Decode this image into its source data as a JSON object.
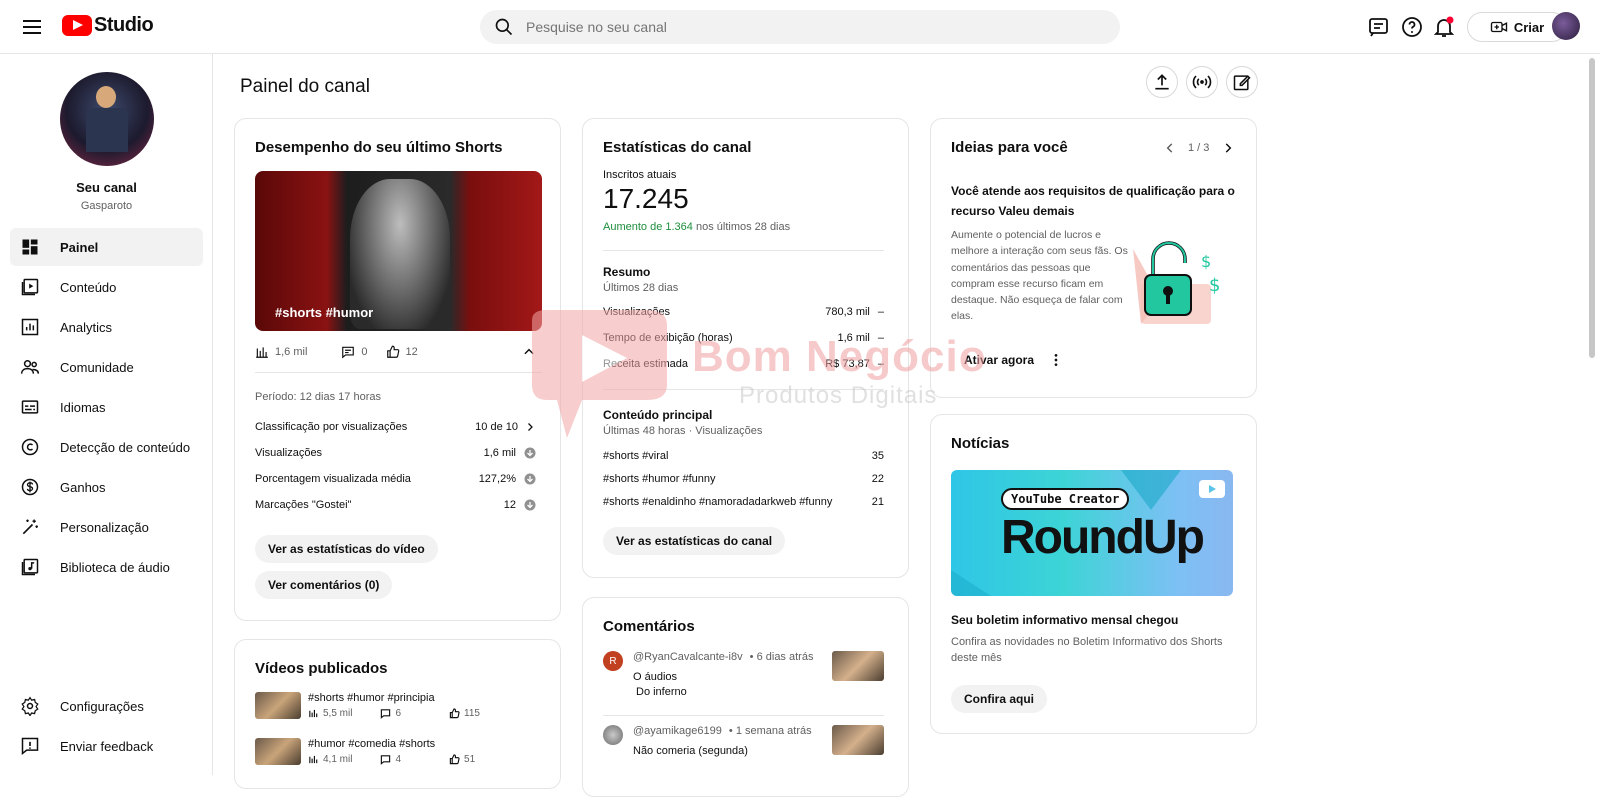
{
  "topbar": {
    "logo_text": "Studio",
    "search_placeholder": "Pesquise no seu canal",
    "create_label": "Criar"
  },
  "sidebar": {
    "channel_name": "Seu canal",
    "channel_handle": "Gasparoto",
    "items": [
      {
        "label": "Painel",
        "icon": "dashboard-icon",
        "active": true
      },
      {
        "label": "Conteúdo",
        "icon": "content-icon"
      },
      {
        "label": "Analytics",
        "icon": "analytics-icon"
      },
      {
        "label": "Comunidade",
        "icon": "community-icon"
      },
      {
        "label": "Idiomas",
        "icon": "subtitles-icon"
      },
      {
        "label": "Detecção de conteúdo",
        "icon": "copyright-icon"
      },
      {
        "label": "Ganhos",
        "icon": "dollar-icon"
      },
      {
        "label": "Personalização",
        "icon": "magic-wand-icon"
      },
      {
        "label": "Biblioteca de áudio",
        "icon": "audio-library-icon"
      }
    ],
    "bottom_items": [
      {
        "label": "Configurações",
        "icon": "gear-icon"
      },
      {
        "label": "Enviar feedback",
        "icon": "feedback-icon"
      }
    ]
  },
  "main": {
    "title": "Painel do canal",
    "shorts_card": {
      "title": "Desempenho do seu último Shorts",
      "thumb_caption": "#shorts #humor",
      "views": "1,6 mil",
      "comments": "0",
      "likes": "12",
      "period": "Período: 12 dias 17 horas",
      "rows": [
        {
          "label": "Classificação por visualizações",
          "value": "10 de 10"
        },
        {
          "label": "Visualizações",
          "value": "1,6 mil"
        },
        {
          "label": "Porcentagem visualizada média",
          "value": "127,2%"
        },
        {
          "label": "Marcações \"Gostei\"",
          "value": "12"
        }
      ],
      "btn_stats": "Ver as estatísticas do vídeo",
      "btn_comments": "Ver comentários (0)"
    },
    "videos_card": {
      "title": "Vídeos publicados",
      "videos": [
        {
          "title": "#shorts #humor #principia",
          "views": "5,5 mil",
          "comments": "6",
          "likes": "115"
        },
        {
          "title": "#humor #comedia #shorts",
          "views": "4,1 mil",
          "comments": "4",
          "likes": "51"
        }
      ]
    },
    "stats_card": {
      "title": "Estatísticas do canal",
      "subs_label": "Inscritos atuais",
      "subs_value": "17.245",
      "increase": "Aumento de 1.364",
      "increase_suffix": " nos últimos 28 dias",
      "summary_title": "Resumo",
      "summary_period": "Últimos 28 dias",
      "summary_rows": [
        {
          "label": "Visualizações",
          "value": "780,3 mil"
        },
        {
          "label": "Tempo de exibição (horas)",
          "value": "1,6 mil"
        },
        {
          "label": "Receita estimada",
          "value": "R$ 73,87"
        }
      ],
      "top_title": "Conteúdo principal",
      "top_period": "Últimas 48 horas · Visualizações",
      "top_rows": [
        {
          "label": "#shorts #viral",
          "value": "35"
        },
        {
          "label": "#shorts #humor #funny",
          "value": "22"
        },
        {
          "label": "#shorts #enaldinho #namoradadarkweb #funny",
          "value": "21"
        }
      ],
      "btn": "Ver as estatísticas do canal"
    },
    "comments_card": {
      "title": "Comentários",
      "items": [
        {
          "author": "@RyanCavalcante-i8v",
          "time": "• 6 dias atrás",
          "initial": "R",
          "lines": [
            "O áudios",
            "Do inferno"
          ],
          "color": "#c1401f"
        },
        {
          "author": "@ayamikage6199",
          "time": "• 1 semana atrás",
          "initial": "",
          "lines": [
            "Não comeria (segunda)"
          ],
          "color": "#9c9c9c"
        }
      ]
    },
    "ideas_card": {
      "title": "Ideias para você",
      "pager": "1 / 3",
      "heading": "Você atende aos requisitos de qualificação para o recurso Valeu demais",
      "body": "Aumente o potencial de lucros e melhore a interação com seus fãs. Os comentários das pessoas que compram esse recurso ficam em destaque. Não esqueça de falar com elas.",
      "btn": "Ativar agora"
    },
    "news_card": {
      "title": "Notícias",
      "badge": "YouTube Creator",
      "banner": "RoundUp",
      "headline": "Seu boletim informativo mensal chegou",
      "body": "Confira as novidades no Boletim Informativo dos Shorts deste mês",
      "btn": "Confira aqui"
    },
    "watermark": {
      "line1": "Bom Negócio",
      "line2": "Produtos Digitais"
    }
  }
}
